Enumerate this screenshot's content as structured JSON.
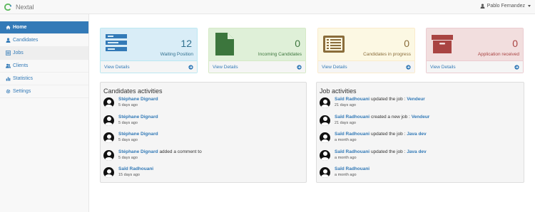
{
  "app": {
    "brand": "Nextal"
  },
  "user": {
    "name": "Pablo Fernandez"
  },
  "sidebar": {
    "items": [
      {
        "label": "Home",
        "icon": "home-icon"
      },
      {
        "label": "Candidates",
        "icon": "user-icon"
      },
      {
        "label": "Jobs",
        "icon": "list-icon"
      },
      {
        "label": "Clients",
        "icon": "users-icon"
      },
      {
        "label": "Statistics",
        "icon": "bar-chart-icon"
      },
      {
        "label": "Settings",
        "icon": "gear-icon"
      }
    ]
  },
  "panels": [
    {
      "count": "12",
      "label": "Waiting Position",
      "footer": "View Details",
      "icon": "tasks-icon",
      "color": "#31708f"
    },
    {
      "count": "0",
      "label": "Incoming Candidates",
      "footer": "View Details",
      "icon": "file-icon",
      "color": "#3c763d"
    },
    {
      "count": "0",
      "label": "Candidates in progress",
      "footer": "View Details",
      "icon": "list-alt-icon",
      "color": "#8a6d3b"
    },
    {
      "count": "0",
      "label": "Application received",
      "footer": "View Details",
      "icon": "archive-icon",
      "color": "#a94442"
    }
  ],
  "candidates_activities": {
    "title": "Candidates activities",
    "items": [
      {
        "who": "Stéphane Dignard",
        "action": "",
        "job": "",
        "time": "5 days ago"
      },
      {
        "who": "Stéphane Dignard",
        "action": "",
        "job": "",
        "time": "5 days ago"
      },
      {
        "who": "Stéphane Dignard",
        "action": "",
        "job": "",
        "time": "5 days ago"
      },
      {
        "who": "Stéphane Dignard",
        "action": "added a comment to",
        "job": "",
        "time": "5 days ago"
      },
      {
        "who": "Saïd Radhouani",
        "action": "",
        "job": "",
        "time": "15 days ago"
      }
    ]
  },
  "job_activities": {
    "title": "Job activities",
    "items": [
      {
        "who": "Saïd Radhouani",
        "action": "updated the job :",
        "job": "Vendeur",
        "time": "21 days ago"
      },
      {
        "who": "Saïd Radhouani",
        "action": "created a new job :",
        "job": "Vendeur",
        "time": "21 days ago"
      },
      {
        "who": "Saïd Radhouani",
        "action": "updated the job :",
        "job": "Java dev",
        "time": "a month ago"
      },
      {
        "who": "Saïd Radhouani",
        "action": "updated the job :",
        "job": "Java dev",
        "time": "a month ago"
      },
      {
        "who": "Saïd Radhouani",
        "action": "",
        "job": "",
        "time": "a month ago"
      }
    ]
  }
}
